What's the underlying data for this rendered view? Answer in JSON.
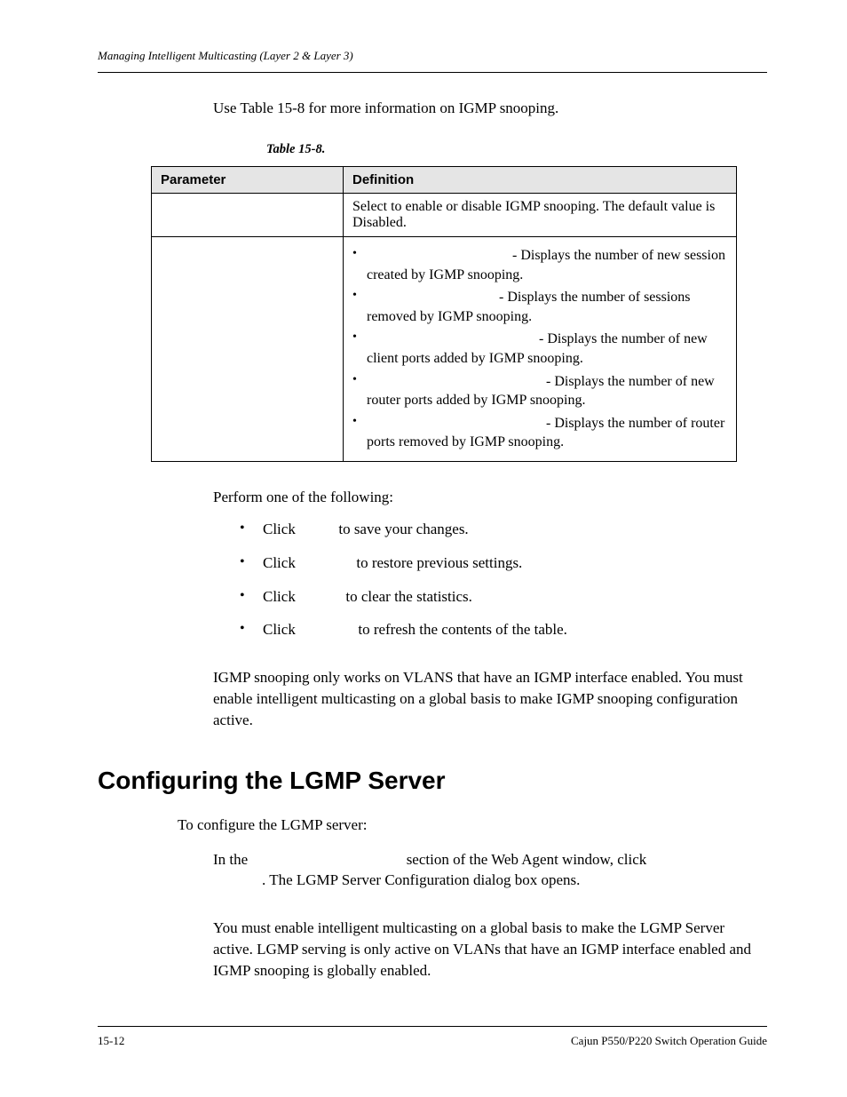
{
  "header": {
    "running": "Managing Intelligent Multicasting (Layer 2 & Layer 3)"
  },
  "intro": "Use Table 15-8 for more information on IGMP snooping.",
  "table": {
    "caption": "Table 15-8.",
    "head_param": "Parameter",
    "head_def": "Definition",
    "row1_def": "Select to enable or disable IGMP snooping. The default value is Disabled.",
    "row2_items": {
      "a": " - Displays the number of new session created by IGMP snooping.",
      "b": " - Displays the number of sessions removed by IGMP snooping.",
      "c": " - Displays the number of new client ports added by IGMP snooping.",
      "d": " - Displays the number of new router ports added by IGMP snooping.",
      "e": " - Displays the number of router ports removed by IGMP snooping."
    }
  },
  "perform": {
    "intro": "Perform one of the following:",
    "a_pre": "Click ",
    "a_post": " to save your changes.",
    "b_pre": "Click ",
    "b_post": " to restore previous settings.",
    "c_pre": "Click ",
    "c_post": " to clear the statistics.",
    "d_pre": "Click ",
    "d_post": " to refresh the contents of the table."
  },
  "note1": " IGMP snooping only works on VLANS that have an IGMP interface enabled. You must enable intelligent multicasting on a global basis to make IGMP snooping configuration active.",
  "section_heading": "Configuring the LGMP Server",
  "sub_intro": "To configure the LGMP server:",
  "step_para_a": "In the ",
  "step_para_b": " section of the Web Agent window, click ",
  "step_para_c": ". The LGMP Server Configuration dialog box opens.",
  "note2": " You must enable intelligent multicasting on a global basis to make the LGMP Server active. LGMP serving is only active on VLANs that have an IGMP interface enabled and IGMP snooping is globally enabled.",
  "footer": {
    "left": "15-12",
    "right": "Cajun P550/P220 Switch Operation Guide"
  }
}
